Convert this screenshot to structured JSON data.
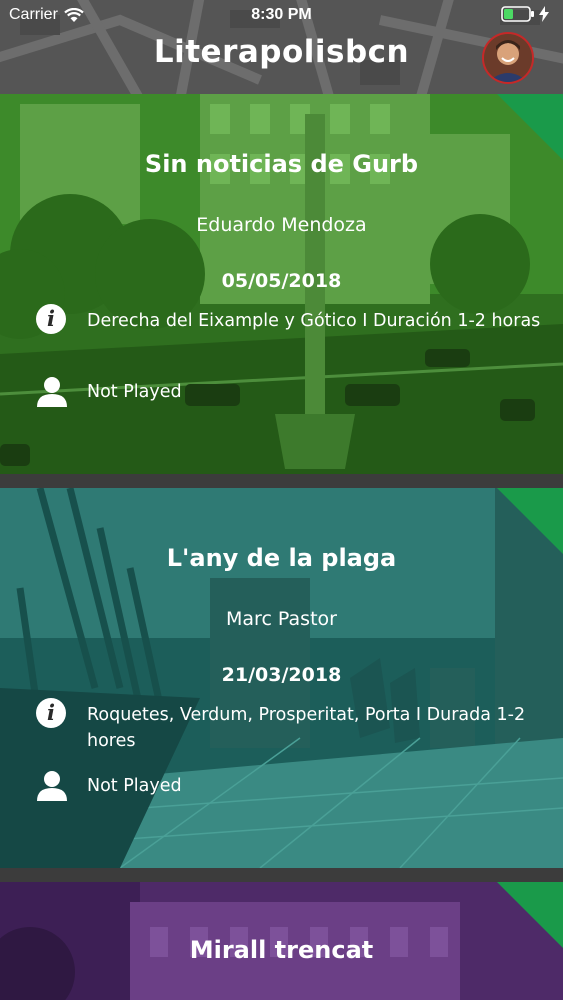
{
  "status_bar": {
    "carrier": "Carrier",
    "time": "8:30 PM"
  },
  "header": {
    "title": "Literapolisbcn"
  },
  "colors": {
    "card1_tint": "#1f7a1f",
    "card2_tint": "#0e6b63",
    "card3_tint": "#5a2a78",
    "corner_green": "#1a9a4a"
  },
  "cards": [
    {
      "title": "Sin noticias de Gurb",
      "author": "Eduardo Mendoza",
      "date": "05/05/2018",
      "route": "Derecha del Eixample y Gótico I Duración 1-2 horas",
      "status": "Not Played"
    },
    {
      "title": "L'any de la plaga",
      "author": "Marc Pastor",
      "date": "21/03/2018",
      "route": "Roquetes, Verdum, Prosperitat, Porta I Durada 1-2 hores",
      "status": "Not Played"
    },
    {
      "title": "Mirall trencat"
    }
  ]
}
